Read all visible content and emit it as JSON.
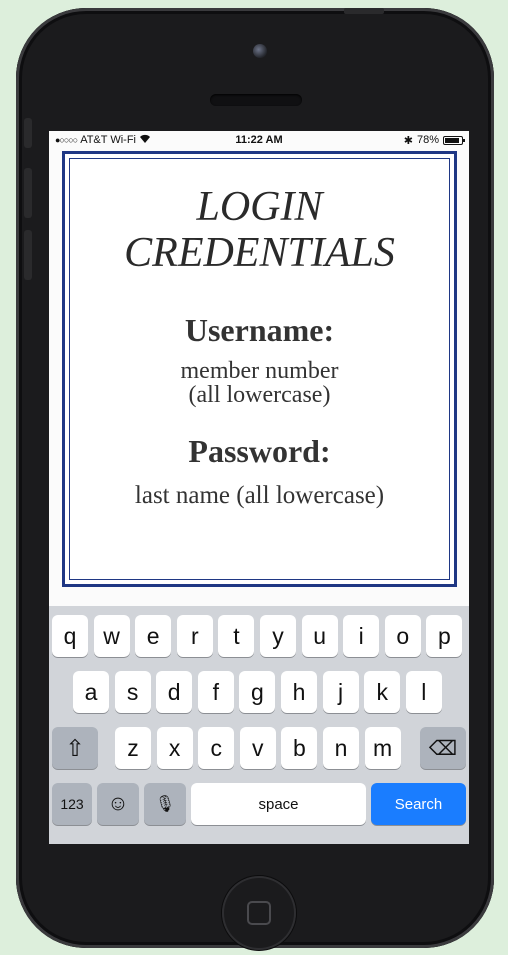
{
  "status_bar": {
    "carrier": "AT&T Wi-Fi",
    "signal_dots": "●○○○○",
    "wifi_icon": "wifi-icon",
    "time": "11:22 AM",
    "bluetooth": "✱",
    "battery": "78%",
    "battery_level": 0.78
  },
  "card": {
    "title_line1": "LOGIN",
    "title_line2": "CREDENTIALS",
    "username_label": "Username:",
    "username_line1": "member number",
    "username_line2": "(all lowercase)",
    "password_label": "Password:",
    "password_value": "last name (all lowercase)",
    "border_color": "#1f3784"
  },
  "keyboard": {
    "row1": [
      "q",
      "w",
      "e",
      "r",
      "t",
      "y",
      "u",
      "i",
      "o",
      "p"
    ],
    "row2": [
      "a",
      "s",
      "d",
      "f",
      "g",
      "h",
      "j",
      "k",
      "l"
    ],
    "row3": [
      "z",
      "x",
      "c",
      "v",
      "b",
      "n",
      "m"
    ],
    "shift_icon": "⇧",
    "backspace_icon": "⌫",
    "numbers_label": "123",
    "emoji_icon": "☺",
    "mic_icon": "🎙",
    "space_label": "space",
    "search_label": "Search",
    "search_color": "#1a7dff"
  }
}
